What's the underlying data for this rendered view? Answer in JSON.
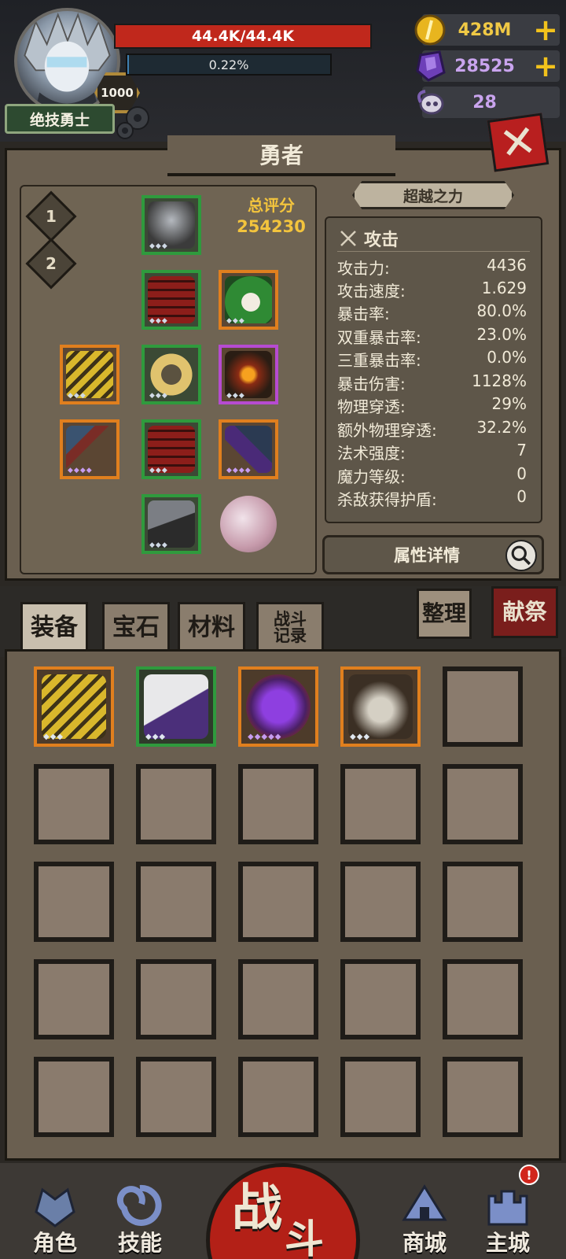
{
  "player": {
    "title": "绝技勇士",
    "level": "1000",
    "hp_text": "44.4K/44.4K",
    "hp_fraction": 1.0,
    "xp_text": "0.22%",
    "xp_fraction": 0.0022
  },
  "currencies": {
    "gold": "428M",
    "gems": "28525",
    "horns": "28"
  },
  "panel": {
    "title": "勇者",
    "loadouts": [
      "1",
      "2"
    ],
    "score_label": "总评分",
    "score_value": "254230",
    "transcend_label": "超越之力"
  },
  "stats": {
    "section_title": "攻击",
    "rows": [
      {
        "label": "攻击力:",
        "value": "4436"
      },
      {
        "label": "攻击速度:",
        "value": "1.629"
      },
      {
        "label": "暴击率:",
        "value": "80.0%"
      },
      {
        "label": "双重暴击率:",
        "value": "23.0%"
      },
      {
        "label": "三重暴击率:",
        "value": "0.0%"
      },
      {
        "label": "暴击伤害:",
        "value": "1128%"
      },
      {
        "label": "物理穿透:",
        "value": "29%"
      },
      {
        "label": "额外物理穿透:",
        "value": "32.2%"
      },
      {
        "label": "法术强度:",
        "value": "7"
      },
      {
        "label": "魔力等级:",
        "value": "0"
      },
      {
        "label": "杀敌获得护盾:",
        "value": "0"
      }
    ],
    "detail_button": "属性详情"
  },
  "tabs": {
    "equipment": "装备",
    "gems": "宝石",
    "materials": "材料",
    "battle_log_line1": "战斗",
    "battle_log_line2": "记录",
    "sort": "整理",
    "offering": "献祭"
  },
  "nav": {
    "character": "角色",
    "skills": "技能",
    "battle_1": "战",
    "battle_2": "斗",
    "shop": "商城",
    "main_city": "主城",
    "alert": "!"
  },
  "colors": {
    "hp_red": "#c0281c",
    "rarity_green": "#2f9a3d",
    "rarity_orange": "#e07f1e",
    "score_gold": "#f3c43d",
    "gem_purple": "#c9a4ee"
  }
}
